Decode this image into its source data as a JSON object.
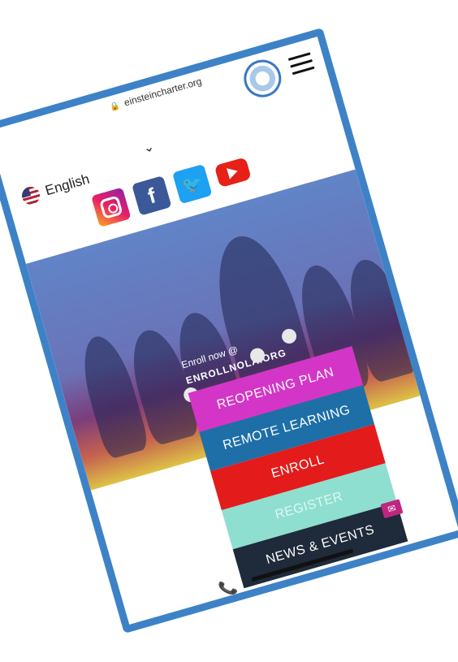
{
  "browser": {
    "url": "einsteincharter.org"
  },
  "header": {
    "language": "English",
    "menu_icon": "hamburger-icon",
    "logo": "school-seal-logo"
  },
  "socials": [
    {
      "name": "instagram",
      "icon": "instagram-icon"
    },
    {
      "name": "facebook",
      "icon": "facebook-icon",
      "glyph": "f"
    },
    {
      "name": "twitter",
      "icon": "twitter-icon",
      "glyph": "🐦"
    },
    {
      "name": "youtube",
      "icon": "youtube-icon"
    }
  ],
  "hero": {
    "enroll_text": "Enroll now @",
    "enroll_url": "ENROLLNOLA.ORG"
  },
  "menu": [
    {
      "label": "REOPENING PLAN",
      "color": "#d336c6"
    },
    {
      "label": "REMOTE LEARNING",
      "color": "#1e6fa7"
    },
    {
      "label": "ENROLL",
      "color": "#e31b1b"
    },
    {
      "label": "REGISTER",
      "color": "#8edfd0"
    },
    {
      "label": "NEWS & EVENTS",
      "color": "#1f2a3a"
    }
  ],
  "footer": {
    "phone_icon": "phone-icon",
    "mail_icon": "mail-icon"
  }
}
